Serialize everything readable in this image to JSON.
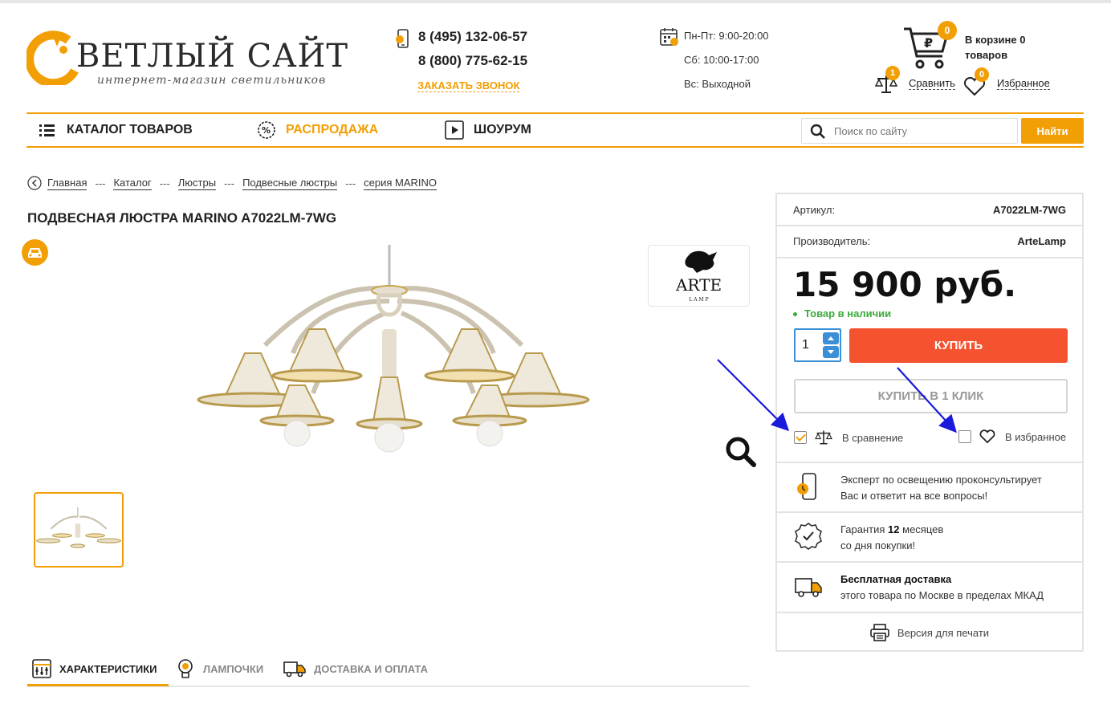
{
  "header": {
    "logo_main": "ВЕТЛЫЙ САЙТ",
    "logo_sub": "интернет-магазин  светильников",
    "phone1": "8 (495) 132-06-57",
    "phone2": "8 (800) 775-62-15",
    "callback": "ЗАКАЗАТЬ ЗВОНОК",
    "hours_weekdays": "Пн-Пт: 9:00-20:00",
    "hours_saturday": "Сб: 10:00-17:00",
    "hours_sunday": "Вс: Выходной",
    "cart_count": "0",
    "cart_text": "В корзине 0 товаров",
    "compare_count": "1",
    "compare_label": "Сравнить",
    "fav_count": "0",
    "fav_label": "Избранное"
  },
  "nav": {
    "catalog": "КАТАЛОГ ТОВАРОВ",
    "sale": "РАСПРОДАЖА",
    "showroom": "ШОУРУМ",
    "search_placeholder": "Поиск по сайту",
    "search_button": "Найти"
  },
  "breadcrumb": [
    "Главная",
    "Каталог",
    "Люстры",
    "Подвесные люстры",
    "серия MARINO"
  ],
  "breadcrumb_sep": "---",
  "product": {
    "title": "ПОДВЕСНАЯ ЛЮСТРА MARINO A7022LM-7WG",
    "brand_logo_text": "ARTE",
    "brand_logo_sub": "L A M P",
    "sku_label": "Артикул:",
    "sku": "A7022LM-7WG",
    "maker_label": "Производитель:",
    "maker": "ArteLamp",
    "price": "15 900 руб.",
    "stock": "Товар в наличии",
    "qty": "1",
    "buy": "КУПИТЬ",
    "one_click": "КУПИТЬ В 1 КЛИК",
    "compare_option": "В сравнение",
    "compare_checked": true,
    "fav_option": "В избранное",
    "fav_checked": false
  },
  "info": {
    "expert_line1": "Эксперт по освещению проконсультирует",
    "expert_line2": "Вас и ответит на все вопросы!",
    "warranty_pre": "Гарантия ",
    "warranty_months": "12",
    "warranty_post": " месяцев",
    "warranty_line2": "со дня покупки!",
    "delivery_title": "Бесплатная доставка",
    "delivery_line2": "этого товара по Москве в пределах МКАД",
    "print": "Версия для печати"
  },
  "tabs": [
    {
      "label": "ХАРАКТЕРИСТИКИ",
      "active": true
    },
    {
      "label": "ЛАМПОЧКИ",
      "active": false
    },
    {
      "label": "ДОСТАВКА И ОПЛАТА",
      "active": false
    }
  ],
  "colors": {
    "accent": "#f29f05",
    "buy": "#f5522f",
    "stock": "#3caa3c",
    "qty_border": "#3a8fd6",
    "annotation_arrow": "#1a1adb"
  }
}
